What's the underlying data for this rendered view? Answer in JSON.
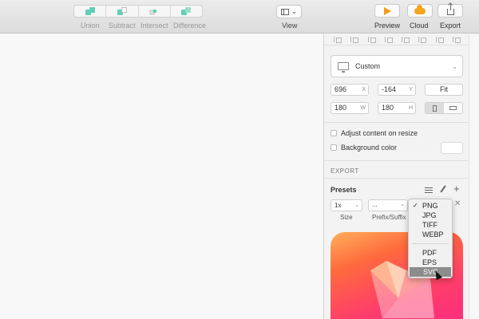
{
  "toolbar": {
    "boolean_ops": [
      {
        "label": "Union",
        "icon": "union-icon"
      },
      {
        "label": "Subtract",
        "icon": "subtract-icon"
      },
      {
        "label": "Intersect",
        "icon": "intersect-icon"
      },
      {
        "label": "Difference",
        "icon": "difference-icon"
      }
    ],
    "view_label": "View",
    "preview_label": "Preview",
    "cloud_label": "Cloud",
    "export_label": "Export",
    "accent_teal": "#5fcfb5",
    "accent_orange": "#f39b17"
  },
  "inspector": {
    "preset_select": "Custom",
    "x_value": "696",
    "x_unit": "X",
    "y_value": "-164",
    "y_unit": "Y",
    "w_value": "180",
    "w_unit": "W",
    "h_value": "180",
    "h_unit": "H",
    "fit_label": "Fit",
    "adjust_content_label": "Adjust content on resize",
    "background_color_label": "Background color",
    "export_section": "EXPORT",
    "presets_label": "Presets",
    "scale_value": "1x",
    "prefix_value": "...",
    "size_label": "Size",
    "prefix_suffix_label": "Prefix/Suffix"
  },
  "format_menu": {
    "items_group1": [
      "PNG",
      "JPG",
      "TIFF",
      "WEBP"
    ],
    "items_group2": [
      "PDF",
      "EPS",
      "SVG"
    ],
    "checked": "PNG",
    "highlighted": "SVG"
  }
}
